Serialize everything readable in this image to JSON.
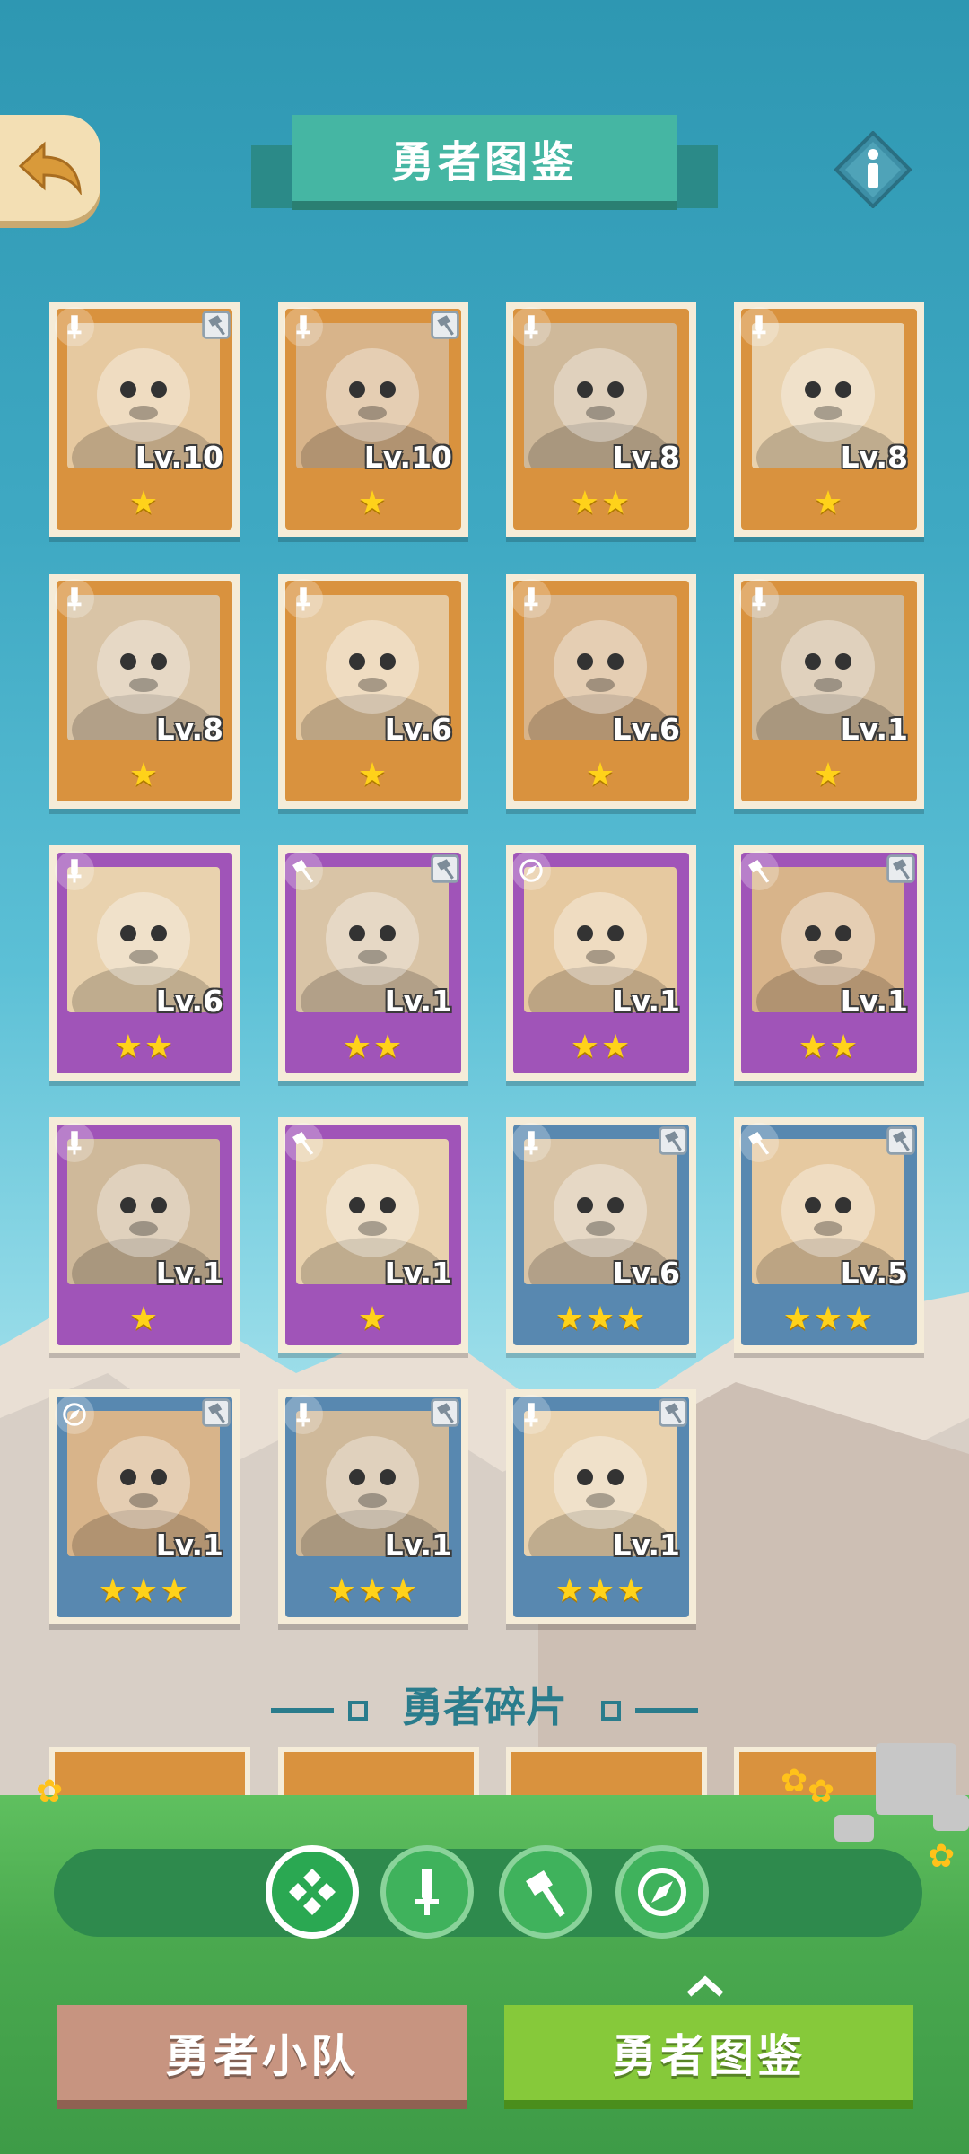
{
  "header": {
    "back_icon": "back-arrow-icon",
    "title": "勇者图鉴",
    "info_icon": "info-icon"
  },
  "heroes": [
    {
      "frame": "orange",
      "class": "sword",
      "level": "Lv.10",
      "stars": 1,
      "has_equip": true
    },
    {
      "frame": "orange",
      "class": "sword",
      "level": "Lv.10",
      "stars": 1,
      "has_equip": true
    },
    {
      "frame": "orange",
      "class": "sword",
      "level": "Lv.8",
      "stars": 2,
      "has_equip": false
    },
    {
      "frame": "orange",
      "class": "sword",
      "level": "Lv.8",
      "stars": 1,
      "has_equip": false
    },
    {
      "frame": "orange",
      "class": "sword",
      "level": "Lv.8",
      "stars": 1,
      "has_equip": false
    },
    {
      "frame": "orange",
      "class": "sword",
      "level": "Lv.6",
      "stars": 1,
      "has_equip": false
    },
    {
      "frame": "orange",
      "class": "sword",
      "level": "Lv.6",
      "stars": 1,
      "has_equip": false
    },
    {
      "frame": "orange",
      "class": "sword",
      "level": "Lv.1",
      "stars": 1,
      "has_equip": false
    },
    {
      "frame": "purple",
      "class": "sword",
      "level": "Lv.6",
      "stars": 2,
      "has_equip": false
    },
    {
      "frame": "purple",
      "class": "hammer",
      "level": "Lv.1",
      "stars": 2,
      "has_equip": true
    },
    {
      "frame": "purple",
      "class": "compass",
      "level": "Lv.1",
      "stars": 2,
      "has_equip": false
    },
    {
      "frame": "purple",
      "class": "hammer",
      "level": "Lv.1",
      "stars": 2,
      "has_equip": true
    },
    {
      "frame": "purple",
      "class": "sword",
      "level": "Lv.1",
      "stars": 1,
      "has_equip": false
    },
    {
      "frame": "purple",
      "class": "hammer",
      "level": "Lv.1",
      "stars": 1,
      "has_equip": false
    },
    {
      "frame": "blue",
      "class": "sword",
      "level": "Lv.6",
      "stars": 3,
      "has_equip": true
    },
    {
      "frame": "blue",
      "class": "hammer",
      "level": "Lv.5",
      "stars": 3,
      "has_equip": true
    },
    {
      "frame": "blue",
      "class": "compass",
      "level": "Lv.1",
      "stars": 3,
      "has_equip": true
    },
    {
      "frame": "blue",
      "class": "sword",
      "level": "Lv.1",
      "stars": 3,
      "has_equip": true
    },
    {
      "frame": "blue",
      "class": "sword",
      "level": "Lv.1",
      "stars": 3,
      "has_equip": true
    }
  ],
  "fragments": {
    "title": "勇者碎片"
  },
  "filters": [
    {
      "icon": "all-classes-icon",
      "active": true
    },
    {
      "icon": "sword-class-icon",
      "active": false
    },
    {
      "icon": "hammer-class-icon",
      "active": false
    },
    {
      "icon": "compass-class-icon",
      "active": false
    }
  ],
  "bottom_nav": {
    "team_label": "勇者小队",
    "atlas_label": "勇者图鉴"
  },
  "colors": {
    "orange_frame": "#d9923e",
    "purple_frame": "#a054b8",
    "blue_frame": "#5888b0",
    "star": "#ffd21a"
  }
}
